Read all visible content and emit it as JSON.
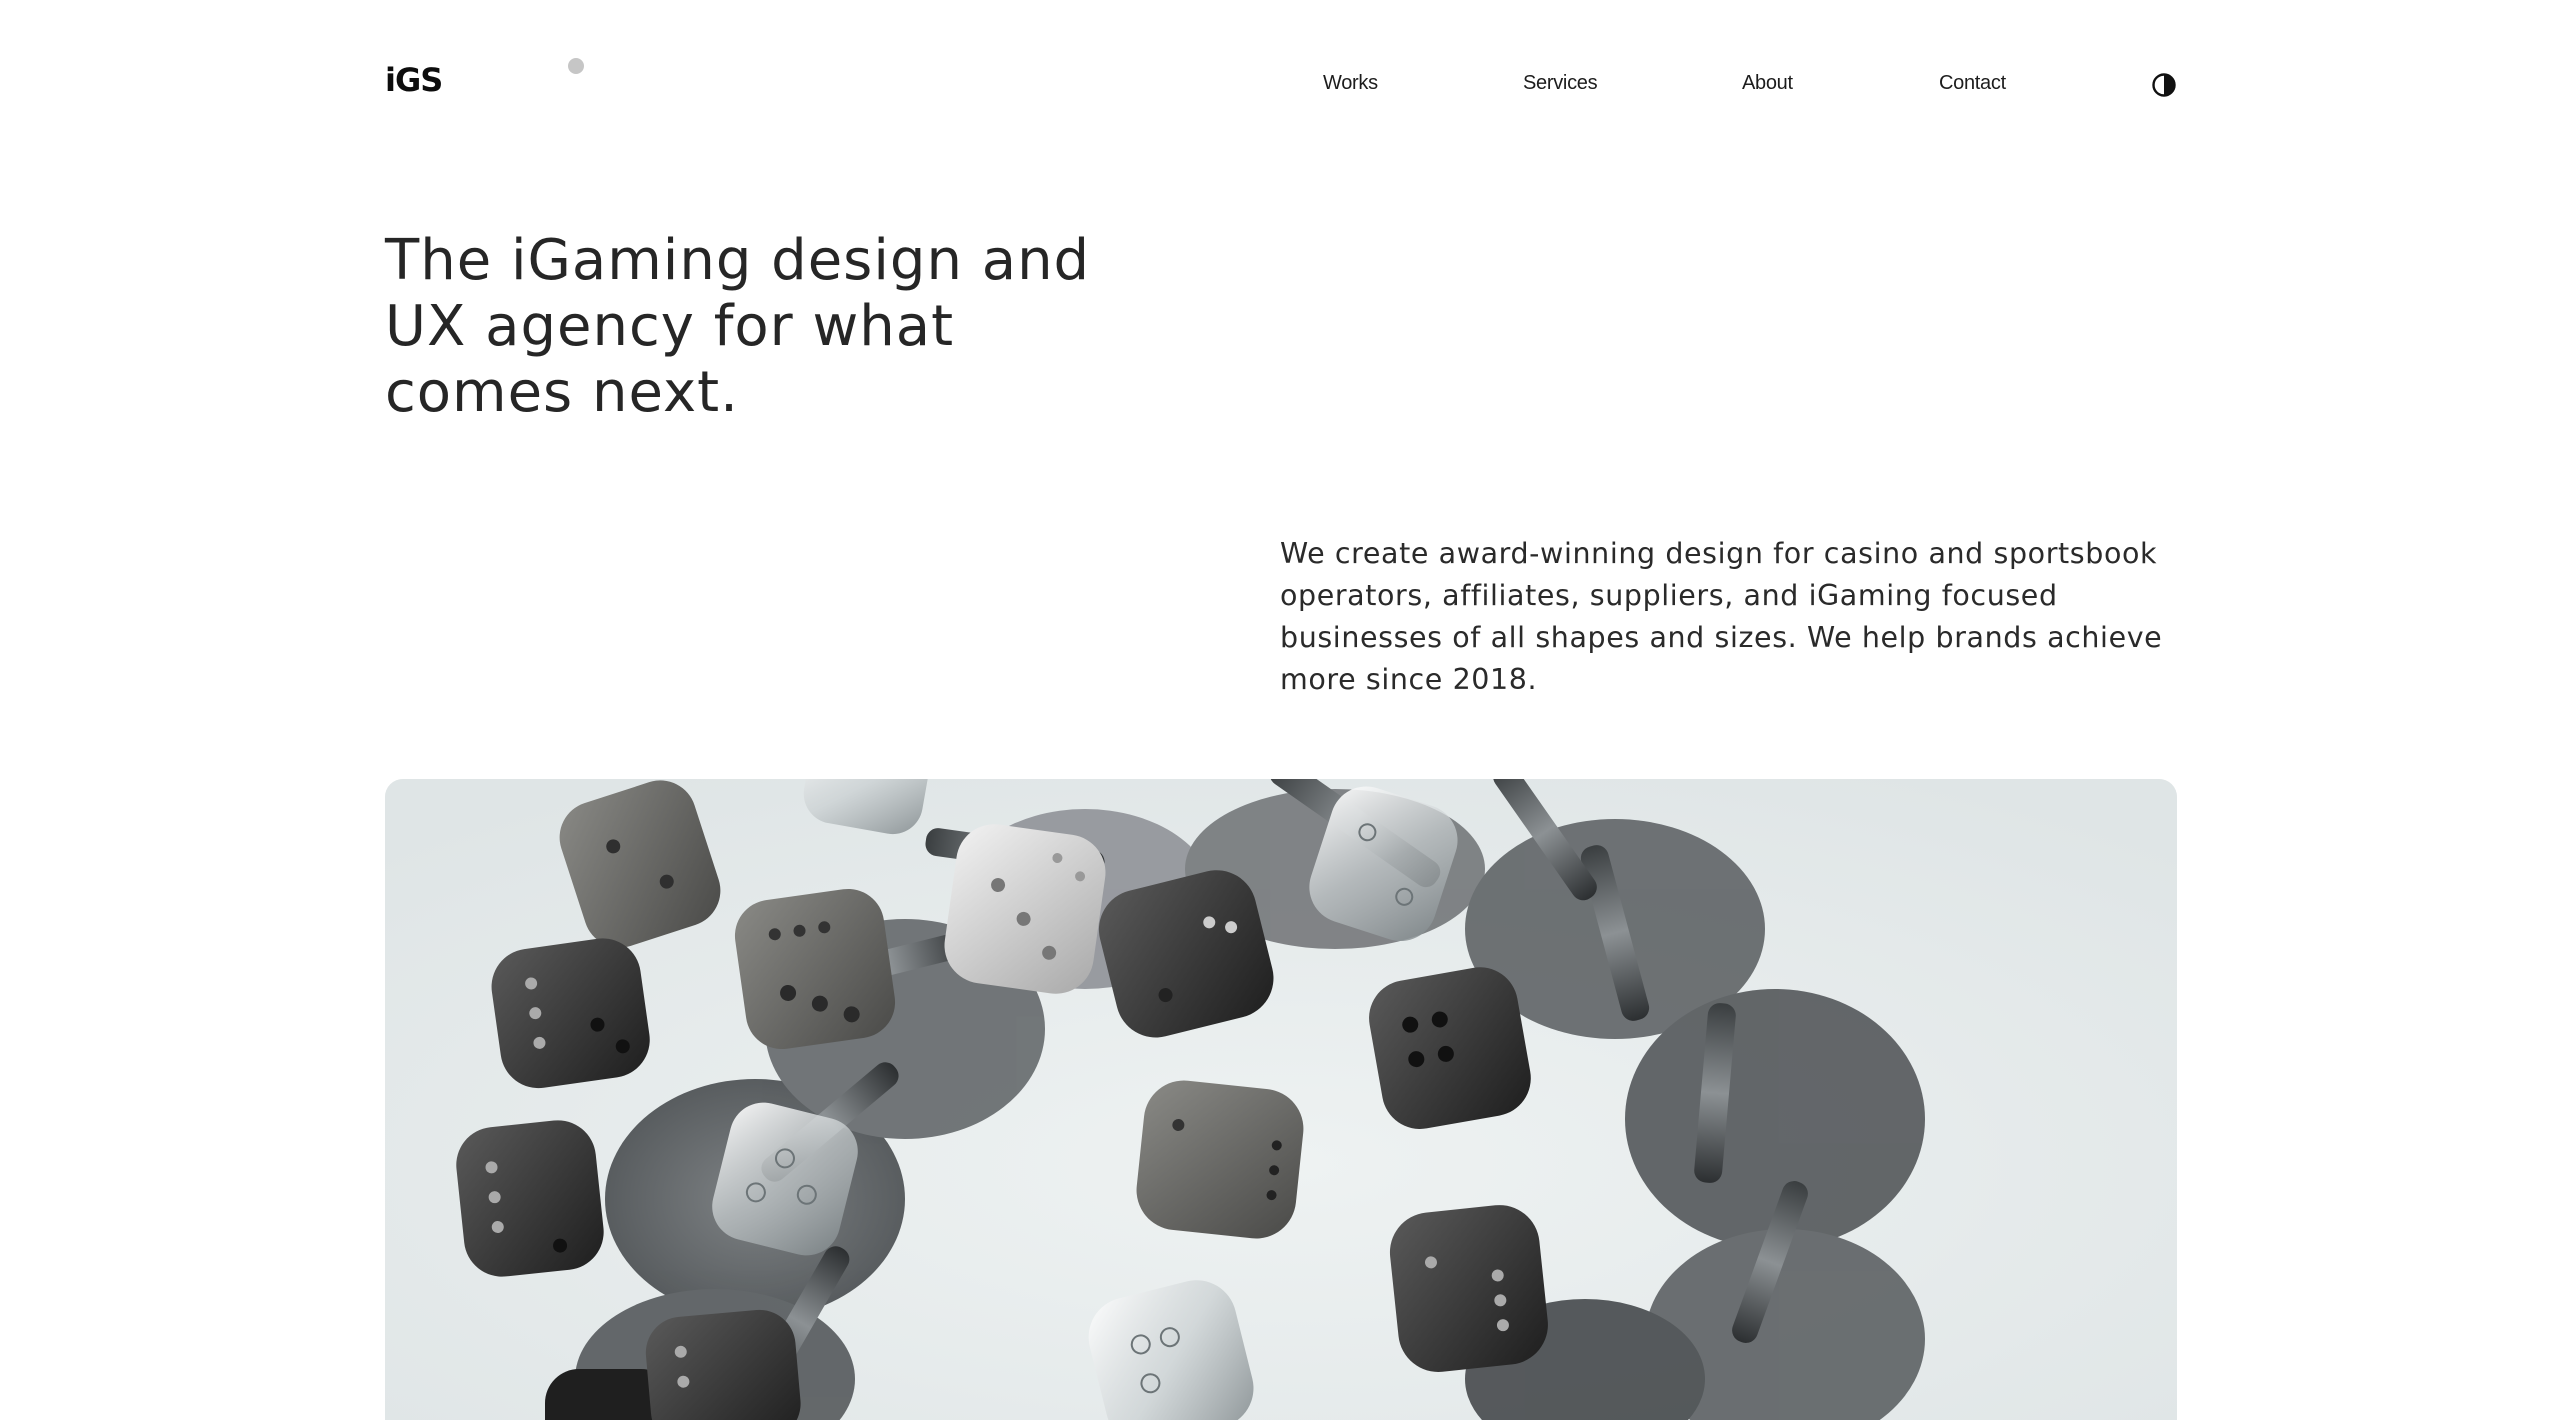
{
  "header": {
    "logo_text": "iGS",
    "nav": {
      "works": "Works",
      "services": "Services",
      "about": "About",
      "contact": "Contact"
    },
    "theme_toggle_icon": "contrast-icon"
  },
  "hero": {
    "headline": "The iGaming design and UX agency for what comes next.",
    "description": "We create award-winning design for casino and sportsbook operators, affiliates, suppliers, and iGaming focused businesses of all shapes and sizes. We help brands achieve more since 2018."
  },
  "media": {
    "subject": "dice-and-chips-ring-image"
  },
  "colors": {
    "background": "#ffffff",
    "text": "#1f1f1f",
    "hero_bg": "#e6eaeb"
  }
}
